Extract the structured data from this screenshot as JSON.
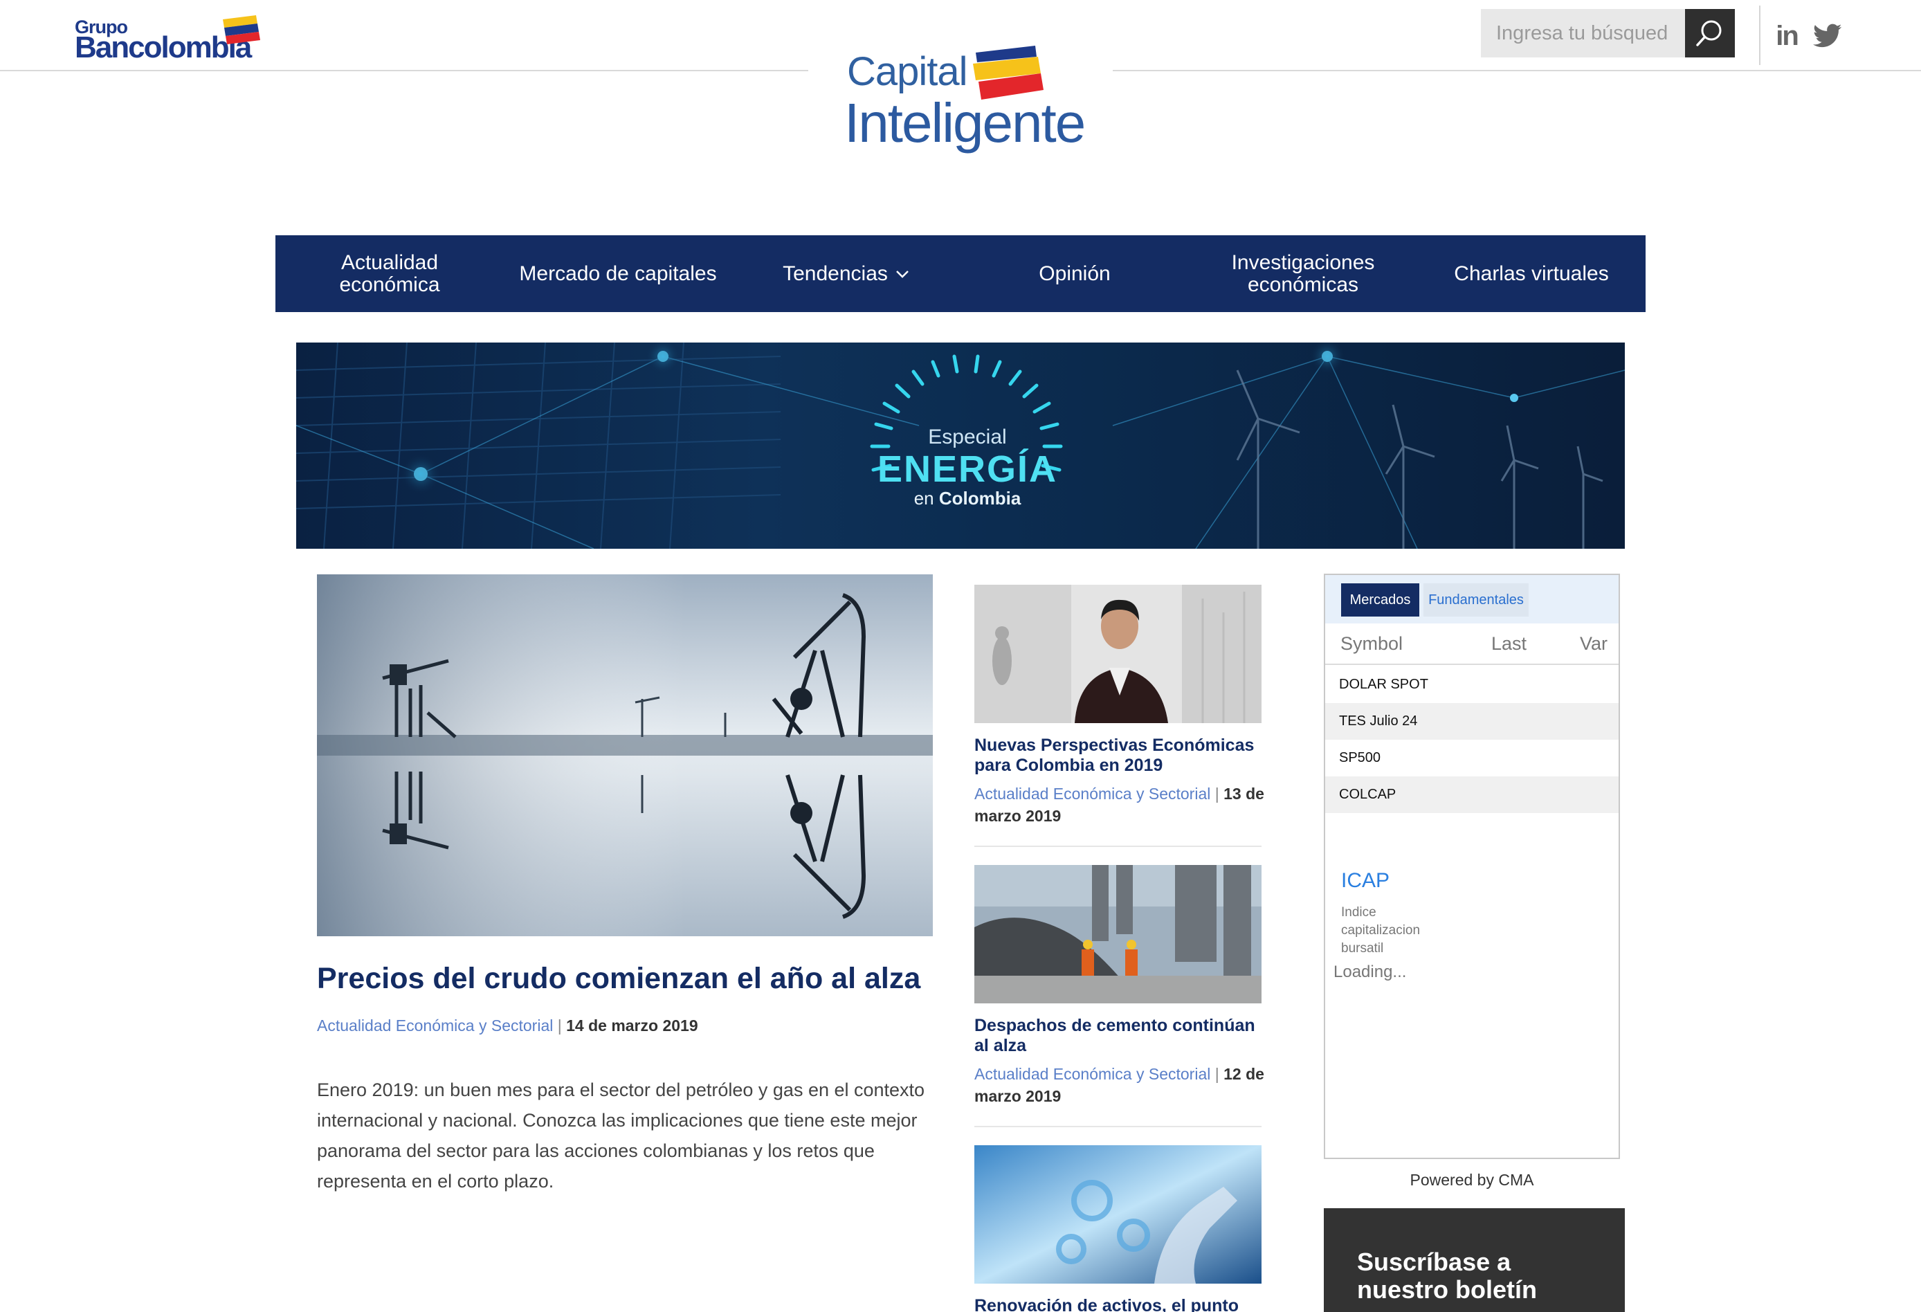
{
  "header": {
    "grupo_small": "Grupo",
    "grupo_big": "Bancolombia",
    "site_logo_line1": "Capital",
    "site_logo_line2": "Inteligente",
    "search_placeholder": "Ingresa tu búsqued",
    "social": {
      "linkedin": "in"
    }
  },
  "nav": {
    "items": [
      {
        "label": "Actualidad económica"
      },
      {
        "label": "Mercado de capitales"
      },
      {
        "label": "Tendencias"
      },
      {
        "label": "Opinión"
      },
      {
        "label": "Investigaciones económicas"
      },
      {
        "label": "Charlas virtuales"
      }
    ]
  },
  "banner": {
    "line1": "Especial",
    "line2": "ENERGÍA",
    "line3_prefix": "en",
    "line3_bold": "Colombia"
  },
  "main_article": {
    "title": "Precios del crudo comienzan el año al alza",
    "category": "Actualidad Económica y Sectorial",
    "separator": "|",
    "date": "14 de marzo 2019",
    "body": "Enero 2019: un buen mes para el sector del petróleo y gas en el contexto internacional y nacional. Conozca las implicaciones que tiene este mejor panorama del sector para las acciones colombianas y los retos que representa en el corto plazo."
  },
  "side_articles": [
    {
      "title": "Nuevas Perspectivas Económicas para Colombia en 2019",
      "category": "Actualidad Económica y Sectorial",
      "separator": "|",
      "date": "13 de marzo 2019"
    },
    {
      "title": "Despachos de cemento continúan al alza",
      "category": "Actualidad Económica y Sectorial",
      "separator": "|",
      "date": "12 de marzo 2019"
    },
    {
      "title": "Renovación de activos, el punto"
    }
  ],
  "market_widget": {
    "tabs": [
      "Mercados",
      "Fundamentales"
    ],
    "columns": [
      "Symbol",
      "Last",
      "Var"
    ],
    "rows": [
      "DOLAR SPOT",
      "TES Julio 24",
      "SP500",
      "COLCAP"
    ],
    "icap_title": "ICAP",
    "icap_desc": "Indice capitalizacion bursatil",
    "loading": "Loading..."
  },
  "powered_by": "Powered by CMA",
  "newsletter": {
    "title": "Suscríbase a nuestro boletín"
  },
  "colors": {
    "nav_bg": "#142c63",
    "category_link": "#5a7fc8",
    "title_blue": "#142c63"
  }
}
